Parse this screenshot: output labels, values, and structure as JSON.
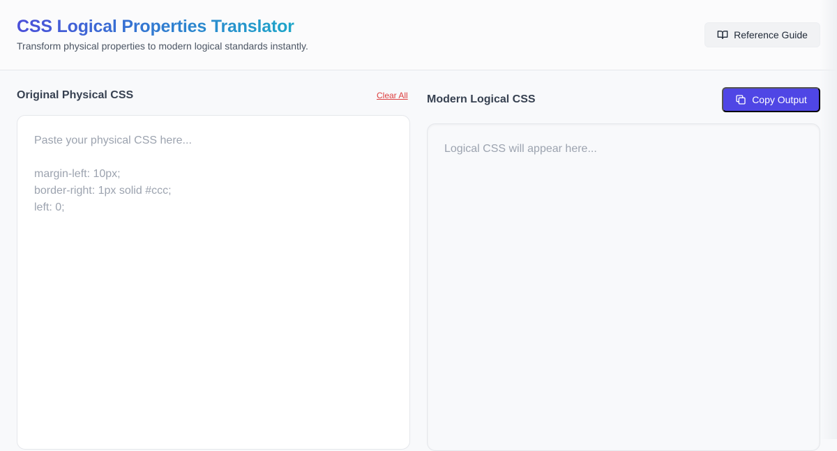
{
  "header": {
    "title": "CSS Logical Properties Translator",
    "subtitle": "Transform physical properties to modern logical standards instantly.",
    "reference_button": {
      "label": "Reference Guide",
      "icon": "book-open-icon"
    }
  },
  "input_pane": {
    "title": "Original Physical CSS",
    "clear_label": "Clear All",
    "value": "",
    "placeholder": "Paste your physical CSS here...\n\nmargin-left: 10px;\nborder-right: 1px solid #ccc;\nleft: 0;"
  },
  "output_pane": {
    "title": "Modern Logical CSS",
    "copy_button": {
      "label": "Copy Output",
      "icon": "copy-icon"
    },
    "value": "",
    "placeholder": "Logical CSS will appear here..."
  },
  "colors": {
    "accent": "#4f46e5",
    "danger": "#dc3d3d",
    "title_gradient": [
      "#4b4fd9",
      "#1ea6c9"
    ]
  }
}
